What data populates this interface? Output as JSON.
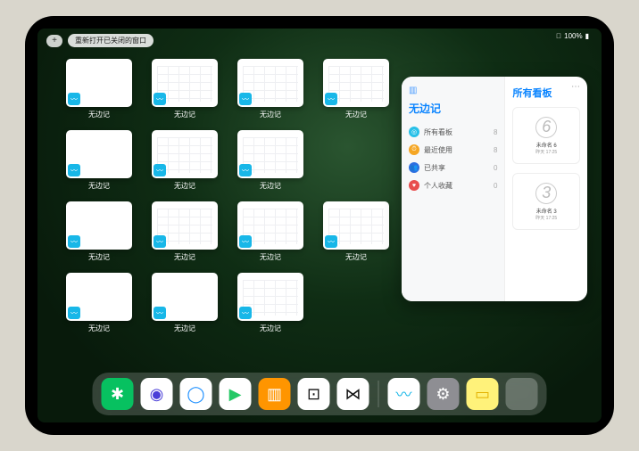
{
  "status": {
    "signal": "􀙇",
    "battery": "100%"
  },
  "topbar": {
    "plus": "+",
    "reopen": "重新打开已关闭的窗口"
  },
  "thumb_label": "无边记",
  "thumbs": [
    {
      "variant": "blank"
    },
    {
      "variant": "grid"
    },
    {
      "variant": "grid"
    },
    {
      "variant": "grid"
    },
    {
      "variant": "blank"
    },
    {
      "variant": "grid"
    },
    {
      "variant": "grid"
    },
    {
      "variant": "blank"
    },
    {
      "variant": "grid"
    },
    {
      "variant": "grid"
    },
    {
      "variant": "grid"
    },
    {
      "variant": "blank"
    },
    {
      "variant": "blank"
    },
    {
      "variant": "grid"
    }
  ],
  "row_spans": [
    4,
    3,
    4,
    3
  ],
  "popup": {
    "title": "无边记",
    "right_title": "所有看板",
    "items": [
      {
        "icon": "◎",
        "color": "#28c0e8",
        "label": "所有看板",
        "count": "8"
      },
      {
        "icon": "⏱",
        "color": "#f5a623",
        "label": "最近使用",
        "count": "8"
      },
      {
        "icon": "👥",
        "color": "#2d6fe0",
        "label": "已共享",
        "count": "0"
      },
      {
        "icon": "♥",
        "color": "#e84d4d",
        "label": "个人收藏",
        "count": "0"
      }
    ],
    "boards": [
      {
        "glyph": "6",
        "name": "未命名 6",
        "date": "昨天 17:25"
      },
      {
        "glyph": "3",
        "name": "未命名 3",
        "date": "昨天 17:25"
      }
    ],
    "more": "⋯"
  },
  "dock": [
    {
      "name": "wechat",
      "bg": "#07c160",
      "glyph": "✱"
    },
    {
      "name": "browser-purple",
      "bg": "#ffffff",
      "glyph": "◉",
      "fg": "#4a3fd8"
    },
    {
      "name": "browser-blue",
      "bg": "#ffffff",
      "glyph": "◯",
      "fg": "#1e90ff"
    },
    {
      "name": "video",
      "bg": "#ffffff",
      "glyph": "▶",
      "fg": "#25c866"
    },
    {
      "name": "books",
      "bg": "#ff9500",
      "glyph": "▥"
    },
    {
      "name": "game",
      "bg": "#ffffff",
      "glyph": "⊡",
      "fg": "#111"
    },
    {
      "name": "social",
      "bg": "#ffffff",
      "glyph": "⋈",
      "fg": "#111"
    }
  ],
  "dock2": [
    {
      "name": "freeform",
      "bg": "#ffffff",
      "glyph": "〰",
      "fg": "#18b7e8"
    },
    {
      "name": "settings",
      "bg": "#8e8e93",
      "glyph": "⚙"
    },
    {
      "name": "notes",
      "bg": "#fff27a",
      "glyph": "▭",
      "fg": "#e3b000"
    }
  ]
}
